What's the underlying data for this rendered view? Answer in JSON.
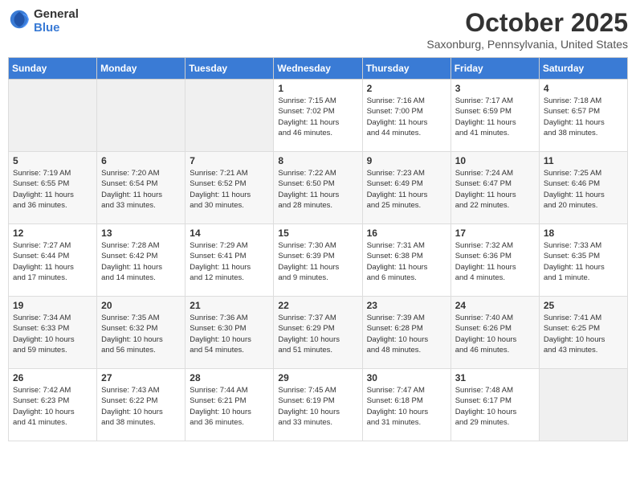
{
  "logo": {
    "text_general": "General",
    "text_blue": "Blue"
  },
  "title": "October 2025",
  "subtitle": "Saxonburg, Pennsylvania, United States",
  "weekdays": [
    "Sunday",
    "Monday",
    "Tuesday",
    "Wednesday",
    "Thursday",
    "Friday",
    "Saturday"
  ],
  "weeks": [
    [
      {
        "day": "",
        "info": ""
      },
      {
        "day": "",
        "info": ""
      },
      {
        "day": "",
        "info": ""
      },
      {
        "day": "1",
        "info": "Sunrise: 7:15 AM\nSunset: 7:02 PM\nDaylight: 11 hours\nand 46 minutes."
      },
      {
        "day": "2",
        "info": "Sunrise: 7:16 AM\nSunset: 7:00 PM\nDaylight: 11 hours\nand 44 minutes."
      },
      {
        "day": "3",
        "info": "Sunrise: 7:17 AM\nSunset: 6:59 PM\nDaylight: 11 hours\nand 41 minutes."
      },
      {
        "day": "4",
        "info": "Sunrise: 7:18 AM\nSunset: 6:57 PM\nDaylight: 11 hours\nand 38 minutes."
      }
    ],
    [
      {
        "day": "5",
        "info": "Sunrise: 7:19 AM\nSunset: 6:55 PM\nDaylight: 11 hours\nand 36 minutes."
      },
      {
        "day": "6",
        "info": "Sunrise: 7:20 AM\nSunset: 6:54 PM\nDaylight: 11 hours\nand 33 minutes."
      },
      {
        "day": "7",
        "info": "Sunrise: 7:21 AM\nSunset: 6:52 PM\nDaylight: 11 hours\nand 30 minutes."
      },
      {
        "day": "8",
        "info": "Sunrise: 7:22 AM\nSunset: 6:50 PM\nDaylight: 11 hours\nand 28 minutes."
      },
      {
        "day": "9",
        "info": "Sunrise: 7:23 AM\nSunset: 6:49 PM\nDaylight: 11 hours\nand 25 minutes."
      },
      {
        "day": "10",
        "info": "Sunrise: 7:24 AM\nSunset: 6:47 PM\nDaylight: 11 hours\nand 22 minutes."
      },
      {
        "day": "11",
        "info": "Sunrise: 7:25 AM\nSunset: 6:46 PM\nDaylight: 11 hours\nand 20 minutes."
      }
    ],
    [
      {
        "day": "12",
        "info": "Sunrise: 7:27 AM\nSunset: 6:44 PM\nDaylight: 11 hours\nand 17 minutes."
      },
      {
        "day": "13",
        "info": "Sunrise: 7:28 AM\nSunset: 6:42 PM\nDaylight: 11 hours\nand 14 minutes."
      },
      {
        "day": "14",
        "info": "Sunrise: 7:29 AM\nSunset: 6:41 PM\nDaylight: 11 hours\nand 12 minutes."
      },
      {
        "day": "15",
        "info": "Sunrise: 7:30 AM\nSunset: 6:39 PM\nDaylight: 11 hours\nand 9 minutes."
      },
      {
        "day": "16",
        "info": "Sunrise: 7:31 AM\nSunset: 6:38 PM\nDaylight: 11 hours\nand 6 minutes."
      },
      {
        "day": "17",
        "info": "Sunrise: 7:32 AM\nSunset: 6:36 PM\nDaylight: 11 hours\nand 4 minutes."
      },
      {
        "day": "18",
        "info": "Sunrise: 7:33 AM\nSunset: 6:35 PM\nDaylight: 11 hours\nand 1 minute."
      }
    ],
    [
      {
        "day": "19",
        "info": "Sunrise: 7:34 AM\nSunset: 6:33 PM\nDaylight: 10 hours\nand 59 minutes."
      },
      {
        "day": "20",
        "info": "Sunrise: 7:35 AM\nSunset: 6:32 PM\nDaylight: 10 hours\nand 56 minutes."
      },
      {
        "day": "21",
        "info": "Sunrise: 7:36 AM\nSunset: 6:30 PM\nDaylight: 10 hours\nand 54 minutes."
      },
      {
        "day": "22",
        "info": "Sunrise: 7:37 AM\nSunset: 6:29 PM\nDaylight: 10 hours\nand 51 minutes."
      },
      {
        "day": "23",
        "info": "Sunrise: 7:39 AM\nSunset: 6:28 PM\nDaylight: 10 hours\nand 48 minutes."
      },
      {
        "day": "24",
        "info": "Sunrise: 7:40 AM\nSunset: 6:26 PM\nDaylight: 10 hours\nand 46 minutes."
      },
      {
        "day": "25",
        "info": "Sunrise: 7:41 AM\nSunset: 6:25 PM\nDaylight: 10 hours\nand 43 minutes."
      }
    ],
    [
      {
        "day": "26",
        "info": "Sunrise: 7:42 AM\nSunset: 6:23 PM\nDaylight: 10 hours\nand 41 minutes."
      },
      {
        "day": "27",
        "info": "Sunrise: 7:43 AM\nSunset: 6:22 PM\nDaylight: 10 hours\nand 38 minutes."
      },
      {
        "day": "28",
        "info": "Sunrise: 7:44 AM\nSunset: 6:21 PM\nDaylight: 10 hours\nand 36 minutes."
      },
      {
        "day": "29",
        "info": "Sunrise: 7:45 AM\nSunset: 6:19 PM\nDaylight: 10 hours\nand 33 minutes."
      },
      {
        "day": "30",
        "info": "Sunrise: 7:47 AM\nSunset: 6:18 PM\nDaylight: 10 hours\nand 31 minutes."
      },
      {
        "day": "31",
        "info": "Sunrise: 7:48 AM\nSunset: 6:17 PM\nDaylight: 10 hours\nand 29 minutes."
      },
      {
        "day": "",
        "info": ""
      }
    ]
  ]
}
